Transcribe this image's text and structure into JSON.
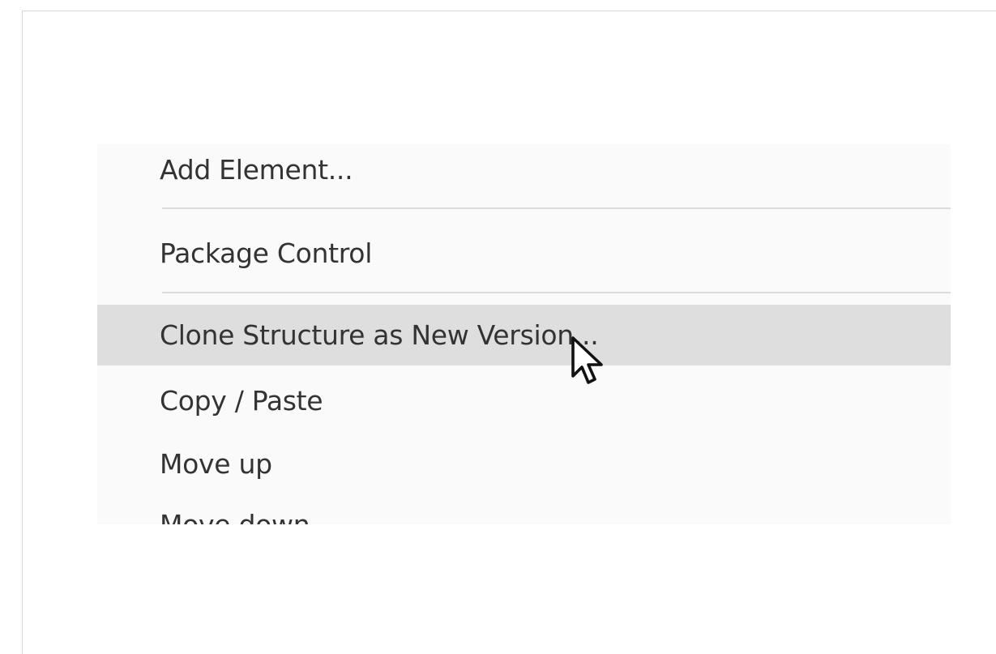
{
  "menu": {
    "items": [
      {
        "label": "Add Element..."
      },
      {
        "label": "Package Control"
      },
      {
        "label": "Clone Structure as New Version..."
      },
      {
        "label": "Copy / Paste"
      },
      {
        "label": "Move up"
      },
      {
        "label": "Move down"
      }
    ],
    "hovered_index": 2
  },
  "cursor": {
    "icon": "mouse-pointer-icon"
  }
}
